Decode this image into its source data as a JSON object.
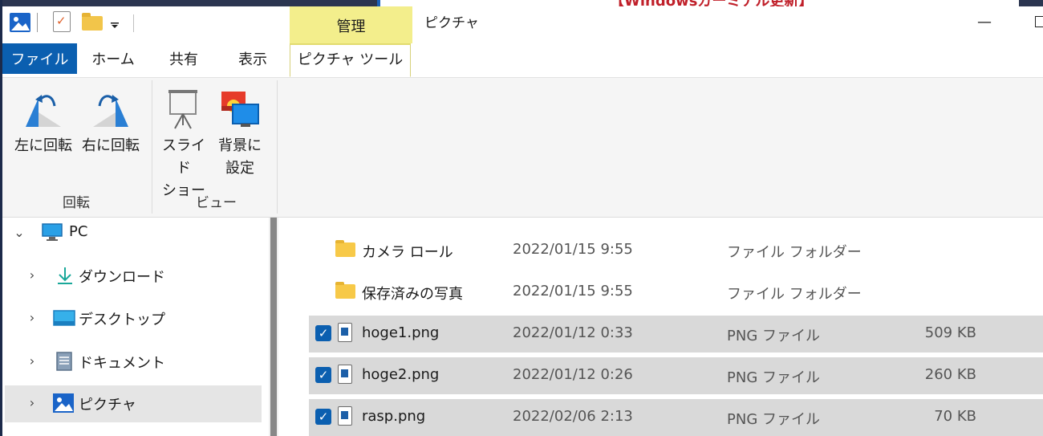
{
  "window": {
    "title": "ピクチャ",
    "context_group": "管理",
    "background_banner": "【Windowsガーミナル更新】"
  },
  "tabs": {
    "file": "ファイル",
    "home": "ホーム",
    "share": "共有",
    "view": "表示",
    "picture_tools": "ピクチャ ツール"
  },
  "ribbon": {
    "rotate_left": "左に回転",
    "rotate_right": "右に回転",
    "slideshow_line1": "スライド",
    "slideshow_line2": "ショー",
    "set_background_line1": "背景に",
    "set_background_line2": "設定",
    "group_rotate": "回転",
    "group_view": "ビュー"
  },
  "nav": {
    "items": [
      {
        "label": "PC",
        "icon": "monitor-icon",
        "expanded": true
      },
      {
        "label": "ダウンロード",
        "icon": "download-arrow-icon"
      },
      {
        "label": "デスクトップ",
        "icon": "desktop-icon"
      },
      {
        "label": "ドキュメント",
        "icon": "document-icon"
      },
      {
        "label": "ピクチャ",
        "icon": "pictures-icon",
        "selected": true
      }
    ]
  },
  "files": {
    "rows": [
      {
        "name": "カメラ ロール",
        "date": "2022/01/15 9:55",
        "type": "ファイル フォルダー",
        "size": "",
        "kind": "folder",
        "selected": false
      },
      {
        "name": "保存済みの写真",
        "date": "2022/01/15 9:55",
        "type": "ファイル フォルダー",
        "size": "",
        "kind": "folder",
        "selected": false
      },
      {
        "name": "hoge1.png",
        "date": "2022/01/12 0:33",
        "type": "PNG ファイル",
        "size": "509 KB",
        "kind": "png",
        "selected": true
      },
      {
        "name": "hoge2.png",
        "date": "2022/01/12 0:26",
        "type": "PNG ファイル",
        "size": "260 KB",
        "kind": "png",
        "selected": true
      },
      {
        "name": "rasp.png",
        "date": "2022/02/06 2:13",
        "type": "PNG ファイル",
        "size": "70 KB",
        "kind": "png",
        "selected": true
      }
    ]
  },
  "colors": {
    "accent": "#0b5fb0",
    "context_tab": "#f3ee8c",
    "selection": "#d9d9d9",
    "ribbon_bg": "#f5f5f5"
  }
}
